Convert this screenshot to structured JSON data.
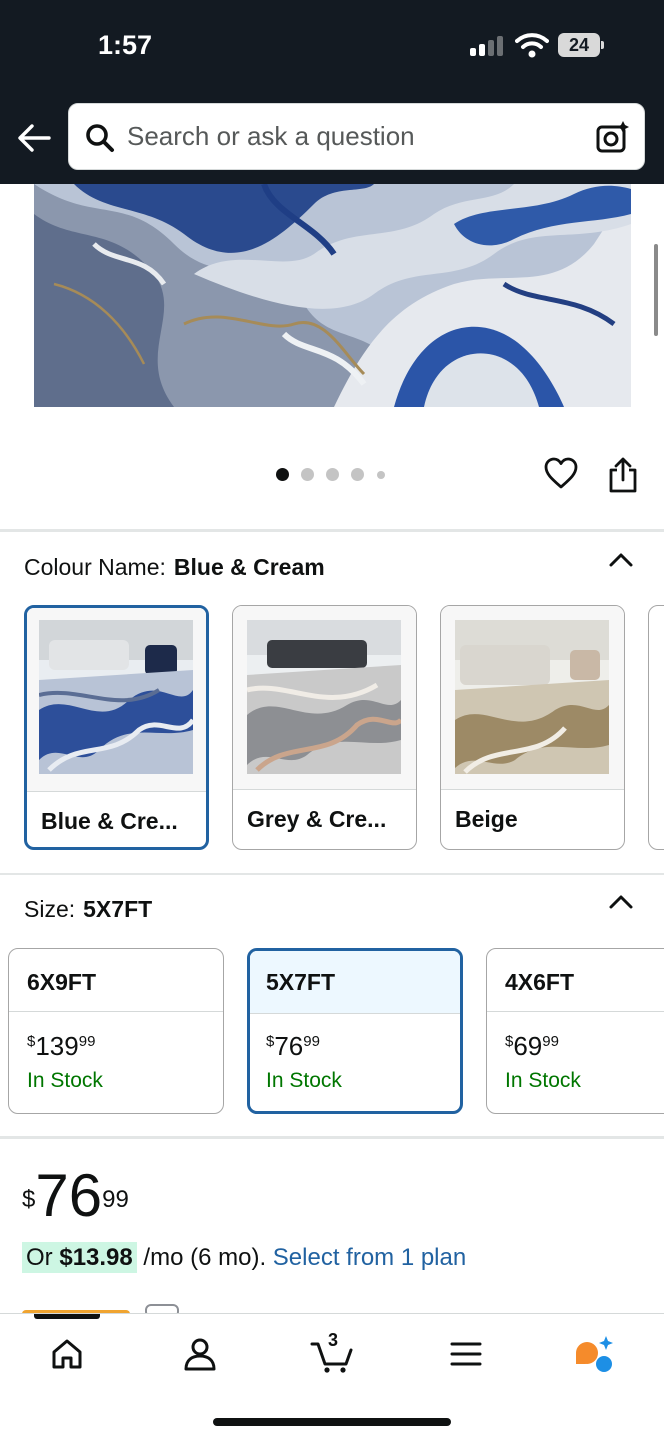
{
  "status_bar": {
    "time": "1:57",
    "battery": "24"
  },
  "search": {
    "placeholder": "Search or ask a question"
  },
  "carousel": {
    "pages": 5,
    "active_page": 1
  },
  "colour": {
    "label": "Colour Name:",
    "selected": "Blue & Cream",
    "options": [
      {
        "label": "Blue & Cre...",
        "selected": true
      },
      {
        "label": "Grey & Cre...",
        "selected": false
      },
      {
        "label": "Beige",
        "selected": false
      }
    ]
  },
  "size": {
    "label": "Size:",
    "selected": "5X7FT",
    "options": [
      {
        "name": "6X9FT",
        "currency": "$",
        "whole": "139",
        "fraction": "99",
        "stock": "In Stock",
        "selected": false
      },
      {
        "name": "5X7FT",
        "currency": "$",
        "whole": "76",
        "fraction": "99",
        "stock": "In Stock",
        "selected": true
      },
      {
        "name": "4X6FT",
        "currency": "$",
        "whole": "69",
        "fraction": "99",
        "stock": "In Stock",
        "selected": false
      }
    ]
  },
  "price": {
    "currency": "$",
    "whole": "76",
    "fraction": "99"
  },
  "installment": {
    "prefix": "Or",
    "amount": "$13.98",
    "term": "/mo (6 mo).",
    "link": "Select from 1 plan"
  },
  "bottom_nav": {
    "cart_count": "3"
  },
  "colors": {
    "header": "#131a22",
    "link": "#2162a1",
    "stock": "#007600",
    "selected_border": "#2162a1"
  }
}
